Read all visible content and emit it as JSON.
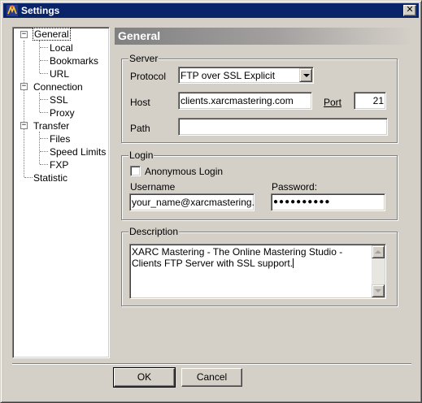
{
  "window": {
    "title": "Settings",
    "close_label": "x"
  },
  "tree": {
    "items": [
      {
        "label": "General",
        "expanded": true,
        "selected": true
      },
      {
        "label": "Local"
      },
      {
        "label": "Bookmarks"
      },
      {
        "label": "URL"
      },
      {
        "label": "Connection",
        "expanded": true
      },
      {
        "label": "SSL"
      },
      {
        "label": "Proxy"
      },
      {
        "label": "Transfer",
        "expanded": true
      },
      {
        "label": "Files"
      },
      {
        "label": "Speed Limits"
      },
      {
        "label": "FXP"
      },
      {
        "label": "Statistic"
      }
    ]
  },
  "panel": {
    "title": "General"
  },
  "server": {
    "group_label": "Server",
    "protocol_label": "Protocol",
    "protocol_value": "FTP over SSL Explicit",
    "host_label": "Host",
    "host_value": "clients.xarcmastering.com",
    "port_label": "Port",
    "port_value": "21",
    "path_label": "Path",
    "path_value": ""
  },
  "login": {
    "group_label": "Login",
    "anonymous_label": "Anonymous Login",
    "anonymous_checked": false,
    "username_label": "Username",
    "username_value": "your_name@xarcmastering.co",
    "password_label": "Password:",
    "password_value": "●●●●●●●●●●"
  },
  "description": {
    "group_label": "Description",
    "text": "XARC Mastering - The Online Mastering Studio - Clients FTP Server with SSL support."
  },
  "buttons": {
    "ok_label": "OK",
    "cancel_label": "Cancel"
  },
  "colors": {
    "titlebar": "#0a246a",
    "face": "#d4d0c8",
    "header_gradient_start": "#808080"
  }
}
